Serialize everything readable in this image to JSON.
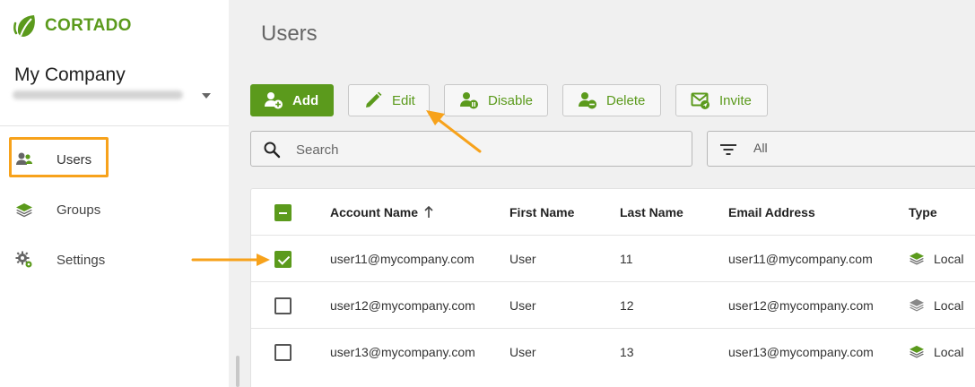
{
  "app": {
    "logo_text": "CORTADO",
    "company_name": "My Company",
    "brand_color": "#5b9a1c",
    "highlight_color": "#f7a21b"
  },
  "sidebar": {
    "items": [
      {
        "label": "Users",
        "icon": "users-icon"
      },
      {
        "label": "Groups",
        "icon": "layers-icon"
      },
      {
        "label": "Settings",
        "icon": "gear-icon"
      }
    ]
  },
  "page": {
    "title": "Users"
  },
  "toolbar": {
    "add_label": "Add",
    "edit_label": "Edit",
    "disable_label": "Disable",
    "delete_label": "Delete",
    "invite_label": "Invite"
  },
  "search": {
    "placeholder": "Search",
    "value": ""
  },
  "filter": {
    "label": "All"
  },
  "table": {
    "columns": [
      "Account Name",
      "First Name",
      "Last Name",
      "Email Address",
      "Type"
    ],
    "sort_column": "Account Name",
    "sort_direction": "ascending",
    "rows": [
      {
        "account": "user11@mycompany.com",
        "first": "User",
        "last": "11",
        "email": "user11@mycompany.com",
        "type": "Local",
        "checked": true
      },
      {
        "account": "user12@mycompany.com",
        "first": "User",
        "last": "12",
        "email": "user12@mycompany.com",
        "type": "Local",
        "checked": false
      },
      {
        "account": "user13@mycompany.com",
        "first": "User",
        "last": "13",
        "email": "user13@mycompany.com",
        "type": "Local",
        "checked": false
      }
    ]
  }
}
